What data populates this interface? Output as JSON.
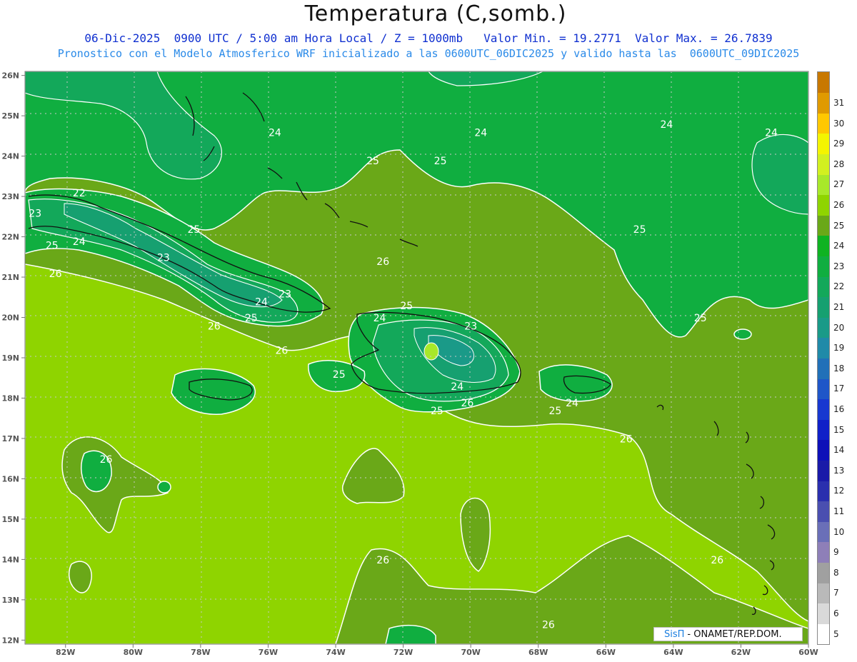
{
  "header": {
    "title": "Temperatura (C,somb.)",
    "line1": "06-Dic-2025  0900 UTC / 5:00 am Hora Local / Z = 1000mb   Valor Min. = 19.2771  Valor Max. = 26.7839",
    "line2": "Pronostico con el Modelo Atmosferico WRF inicializado a las 0600UTC_06DIC2025 y valido hasta las  0600UTC_09DIC2025"
  },
  "map": {
    "lon_range": [
      -83.2,
      -60
    ],
    "lat_range": [
      11.9,
      26.1
    ],
    "lat_ticks": [
      "26N",
      "25N",
      "24N",
      "23N",
      "22N",
      "21N",
      "20N",
      "19N",
      "18N",
      "17N",
      "16N",
      "15N",
      "14N",
      "13N",
      "12N"
    ],
    "lon_ticks": [
      "82W",
      "80W",
      "78W",
      "76W",
      "74W",
      "72W",
      "70W",
      "68W",
      "66W",
      "64W",
      "62W",
      "60W"
    ],
    "contour_labels": [
      {
        "text": "24",
        "lon": -75.8,
        "lat": 24.5
      },
      {
        "text": "24",
        "lon": -69.7,
        "lat": 24.5
      },
      {
        "text": "24",
        "lon": -64.2,
        "lat": 24.7
      },
      {
        "text": "24",
        "lon": -61.1,
        "lat": 24.5
      },
      {
        "text": "25",
        "lon": -72.9,
        "lat": 23.8
      },
      {
        "text": "25",
        "lon": -70.9,
        "lat": 23.8
      },
      {
        "text": "22",
        "lon": -81.6,
        "lat": 23.0
      },
      {
        "text": "23",
        "lon": -82.9,
        "lat": 22.5
      },
      {
        "text": "25",
        "lon": -78.2,
        "lat": 22.1
      },
      {
        "text": "25",
        "lon": -65.0,
        "lat": 22.1
      },
      {
        "text": "24",
        "lon": -81.6,
        "lat": 21.8
      },
      {
        "text": "25",
        "lon": -82.4,
        "lat": 21.7
      },
      {
        "text": "23",
        "lon": -79.1,
        "lat": 21.4
      },
      {
        "text": "26",
        "lon": -72.6,
        "lat": 21.3
      },
      {
        "text": "26",
        "lon": -82.3,
        "lat": 21.0
      },
      {
        "text": "23",
        "lon": -75.5,
        "lat": 20.5
      },
      {
        "text": "24",
        "lon": -76.2,
        "lat": 20.3
      },
      {
        "text": "25",
        "lon": -76.5,
        "lat": 19.9
      },
      {
        "text": "25",
        "lon": -71.9,
        "lat": 20.2
      },
      {
        "text": "24",
        "lon": -72.7,
        "lat": 19.9
      },
      {
        "text": "26",
        "lon": -77.6,
        "lat": 19.7
      },
      {
        "text": "23",
        "lon": -70.0,
        "lat": 19.7
      },
      {
        "text": "25",
        "lon": -63.2,
        "lat": 19.9
      },
      {
        "text": "26",
        "lon": -75.6,
        "lat": 19.1
      },
      {
        "text": "25",
        "lon": -73.9,
        "lat": 18.5
      },
      {
        "text": "24",
        "lon": -70.4,
        "lat": 18.2
      },
      {
        "text": "24",
        "lon": -67.0,
        "lat": 17.8
      },
      {
        "text": "26",
        "lon": -70.1,
        "lat": 17.8
      },
      {
        "text": "25",
        "lon": -71.0,
        "lat": 17.6
      },
      {
        "text": "25",
        "lon": -67.5,
        "lat": 17.6
      },
      {
        "text": "26",
        "lon": -65.4,
        "lat": 16.9
      },
      {
        "text": "26",
        "lon": -80.8,
        "lat": 16.4
      },
      {
        "text": "26",
        "lon": -72.6,
        "lat": 13.9
      },
      {
        "text": "26",
        "lon": -62.7,
        "lat": 13.9
      },
      {
        "text": "26",
        "lon": -67.7,
        "lat": 12.3
      }
    ]
  },
  "colorbar": {
    "labels": [
      "5",
      "6",
      "7",
      "8",
      "9",
      "10",
      "11",
      "12",
      "13",
      "14",
      "15",
      "16",
      "17",
      "18",
      "19",
      "20",
      "21",
      "22",
      "23",
      "24",
      "25",
      "26",
      "27",
      "28",
      "29",
      "30",
      "31"
    ],
    "colors": [
      "#ffffff",
      "#d9d9d9",
      "#b9b9b9",
      "#a0a0a0",
      "#8e7fb8",
      "#6a6fb8",
      "#4a4fb0",
      "#2a2fae",
      "#1a1aa8",
      "#0e10b8",
      "#1020c8",
      "#1838d0",
      "#1f56c8",
      "#2170b8",
      "#208aa8",
      "#1a9a88",
      "#16a070",
      "#13a85a",
      "#10ae40",
      "#0fb322",
      "#6aa818",
      "#8fd400",
      "#a8e82a",
      "#d2f020",
      "#f4f400",
      "#ffc800",
      "#e09a00",
      "#c87800"
    ]
  },
  "credit": {
    "logo": "SisΠ",
    "text": "- ONAMET/REP.DOM."
  }
}
